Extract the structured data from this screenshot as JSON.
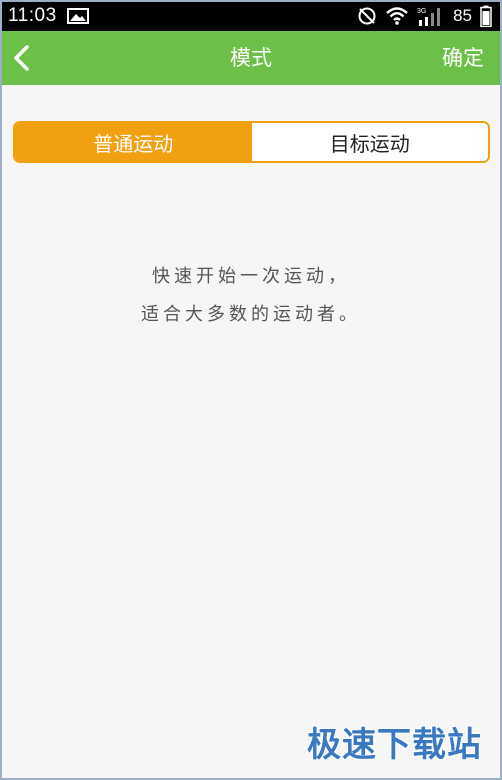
{
  "status_bar": {
    "time": "11:03",
    "battery": "85",
    "network_label": "3G",
    "icons": [
      "image-icon",
      "mute-icon",
      "wifi-icon",
      "signal-icon",
      "battery-icon"
    ]
  },
  "nav": {
    "title": "模式",
    "confirm_label": "确定",
    "back_icon": "chevron-left-icon",
    "background_color": "#6cc04a"
  },
  "tabs": [
    {
      "label": "普通运动",
      "selected": true
    },
    {
      "label": "目标运动",
      "selected": false
    }
  ],
  "accent_color": "#f0a010",
  "description": {
    "line1": "快速开始一次运动，",
    "line2": "适合大多数的运动者。"
  },
  "watermark": "极速下载站"
}
